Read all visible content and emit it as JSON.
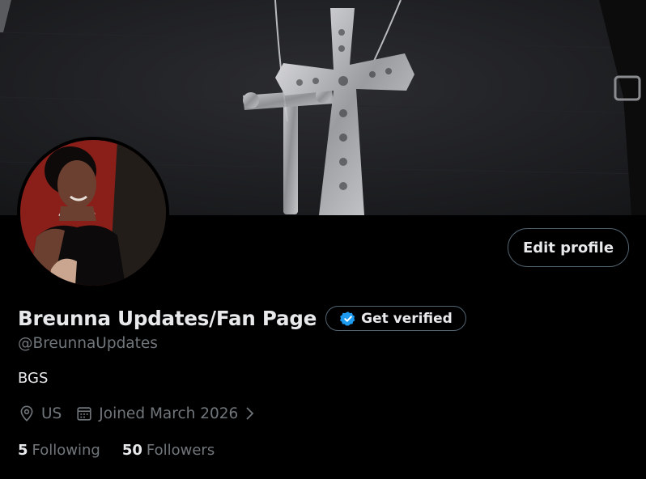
{
  "profile": {
    "display_name": "Breunna Updates/Fan Page",
    "handle": "@BreunnaUpdates",
    "bio": "BGS",
    "location": "US",
    "joined": "Joined March 2026",
    "following_count": "5",
    "following_label": "Following",
    "followers_count": "50",
    "followers_label": "Followers"
  },
  "actions": {
    "edit_profile_label": "Edit profile",
    "get_verified_label": "Get verified"
  },
  "icons": {
    "verified": "verified-badge-icon",
    "location": "location-pin-icon",
    "calendar": "calendar-icon",
    "chevron": "chevron-right-icon"
  },
  "colors": {
    "background": "#000000",
    "text_primary": "#e7e9ea",
    "text_secondary": "#71767b",
    "border": "#536471",
    "verified_blue": "#1d9bf0"
  }
}
